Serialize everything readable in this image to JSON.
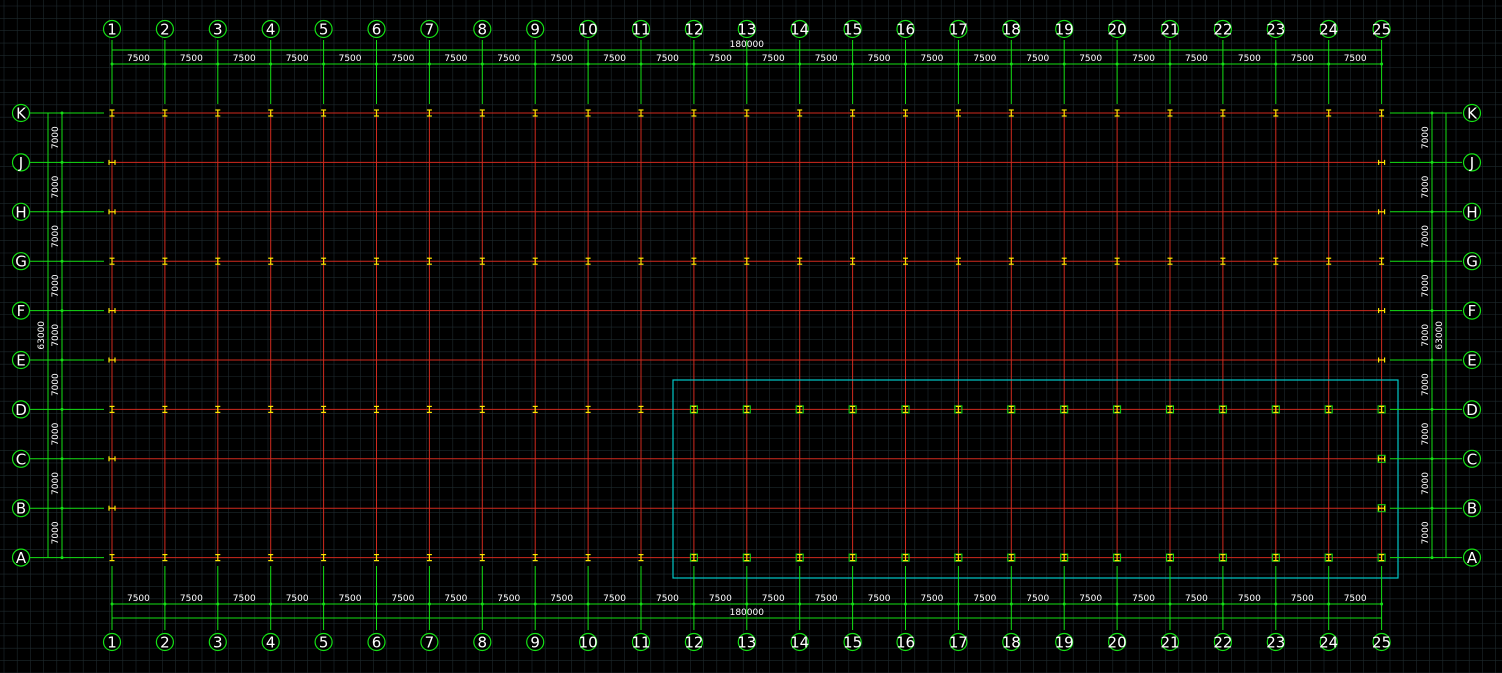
{
  "drawing": {
    "column_labels": [
      "1",
      "2",
      "3",
      "4",
      "5",
      "6",
      "7",
      "8",
      "9",
      "10",
      "11",
      "12",
      "13",
      "14",
      "15",
      "16",
      "17",
      "18",
      "19",
      "20",
      "21",
      "22",
      "23",
      "24",
      "25"
    ],
    "row_labels": [
      "K",
      "J",
      "H",
      "G",
      "F",
      "E",
      "D",
      "C",
      "B",
      "A"
    ],
    "column_spacing": "7500",
    "row_spacing": "7000",
    "total_length": "180000",
    "total_width": "63000",
    "colors": {
      "background": "#000000",
      "grid": "#1e2a2e",
      "axis": "#d02a1e",
      "dimension": "#15e015",
      "column_marker": "#ffe600",
      "highlight": "#00c8c8"
    }
  }
}
